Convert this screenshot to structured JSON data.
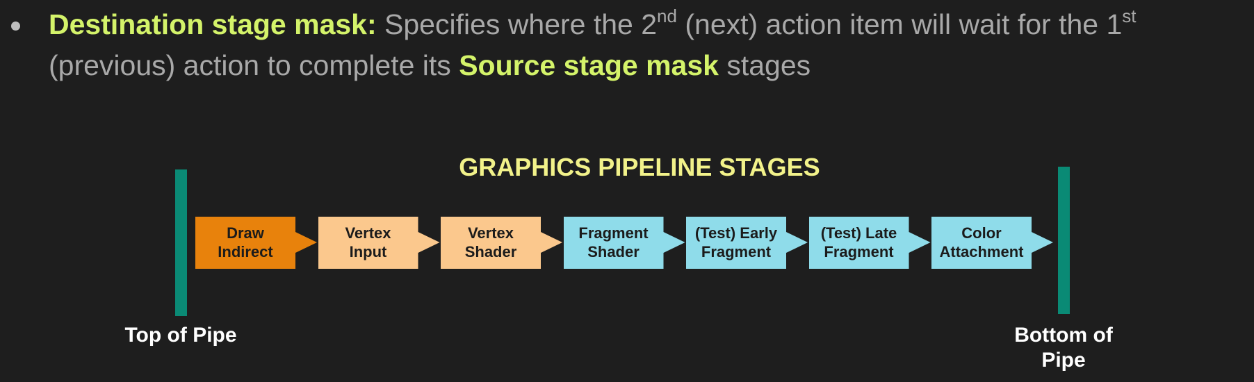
{
  "bullet": {
    "term": "Destination stage mask:",
    "text_1": " Specifies where the 2",
    "sup_1": "nd",
    "text_2": " (next) action item will wait for the 1",
    "sup_2": "st",
    "text_3": " (previous) action to complete its ",
    "term_2": "Source stage mask",
    "text_4": " stages"
  },
  "diagram": {
    "title": "GRAPHICS PIPELINE STAGES",
    "top_label": "Top of Pipe",
    "bottom_label_line1": "Bottom of",
    "bottom_label_line2": "Pipe",
    "stages": [
      {
        "line1": "Draw",
        "line2": "Indirect",
        "color": "#e8820c"
      },
      {
        "line1": "Vertex",
        "line2": "Input",
        "color": "#fbc88d"
      },
      {
        "line1": "Vertex",
        "line2": "Shader",
        "color": "#fbc88d"
      },
      {
        "line1": "Fragment",
        "line2": "Shader",
        "color": "#8fdcea"
      },
      {
        "line1": "(Test) Early",
        "line2": "Fragment",
        "color": "#8fdcea"
      },
      {
        "line1": "(Test) Late",
        "line2": "Fragment",
        "color": "#8fdcea"
      },
      {
        "line1": "Color",
        "line2": "Attachment",
        "color": "#8fdcea"
      }
    ],
    "bar_color": "#0a8a75"
  }
}
